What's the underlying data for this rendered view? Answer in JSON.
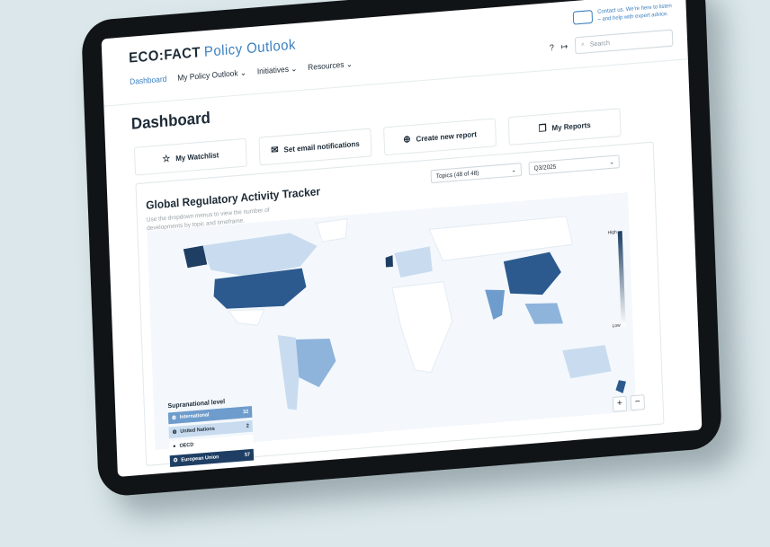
{
  "header": {
    "brand": "ECO:FACT",
    "product": "Policy Outlook",
    "nav": [
      {
        "label": "Dashboard"
      },
      {
        "label": "My Policy Outlook ⌄"
      },
      {
        "label": "Initiatives ⌄"
      },
      {
        "label": "Resources ⌄"
      }
    ],
    "contact_line1": "Contact us. We're here to listen",
    "contact_line2": "– and help with expert advice.",
    "help_icon": "?",
    "logout_icon": "↦",
    "search_placeholder": "Search"
  },
  "page": {
    "title": "Dashboard"
  },
  "actions": [
    {
      "label": "My Watchlist",
      "icon": "☆"
    },
    {
      "label": "Set email notifications",
      "icon": "✉"
    },
    {
      "label": "Create new report",
      "icon": "⊕"
    },
    {
      "label": "My Reports",
      "icon": "❐"
    }
  ],
  "tracker": {
    "title": "Global Regulatory Activity Tracker",
    "description": "Use the dropdown menus to view the number of developments by topic and timeframe.",
    "topics_select": "Topics (48 of 48)",
    "period_select": "Q3/2025",
    "legend_high": "High",
    "legend_low": "Low",
    "supranational_title": "Supranational level",
    "supranational": [
      {
        "label": "International",
        "count": "32"
      },
      {
        "label": "United Nations",
        "count": "2"
      },
      {
        "label": "OECD",
        "count": ""
      },
      {
        "label": "European Union",
        "count": "57"
      }
    ],
    "zoom_in": "+",
    "zoom_out": "−"
  },
  "colors": {
    "accent": "#3a7fbf",
    "dark": "#1e3e63",
    "mid": "#6e9ccc",
    "light": "#c9dcef"
  }
}
